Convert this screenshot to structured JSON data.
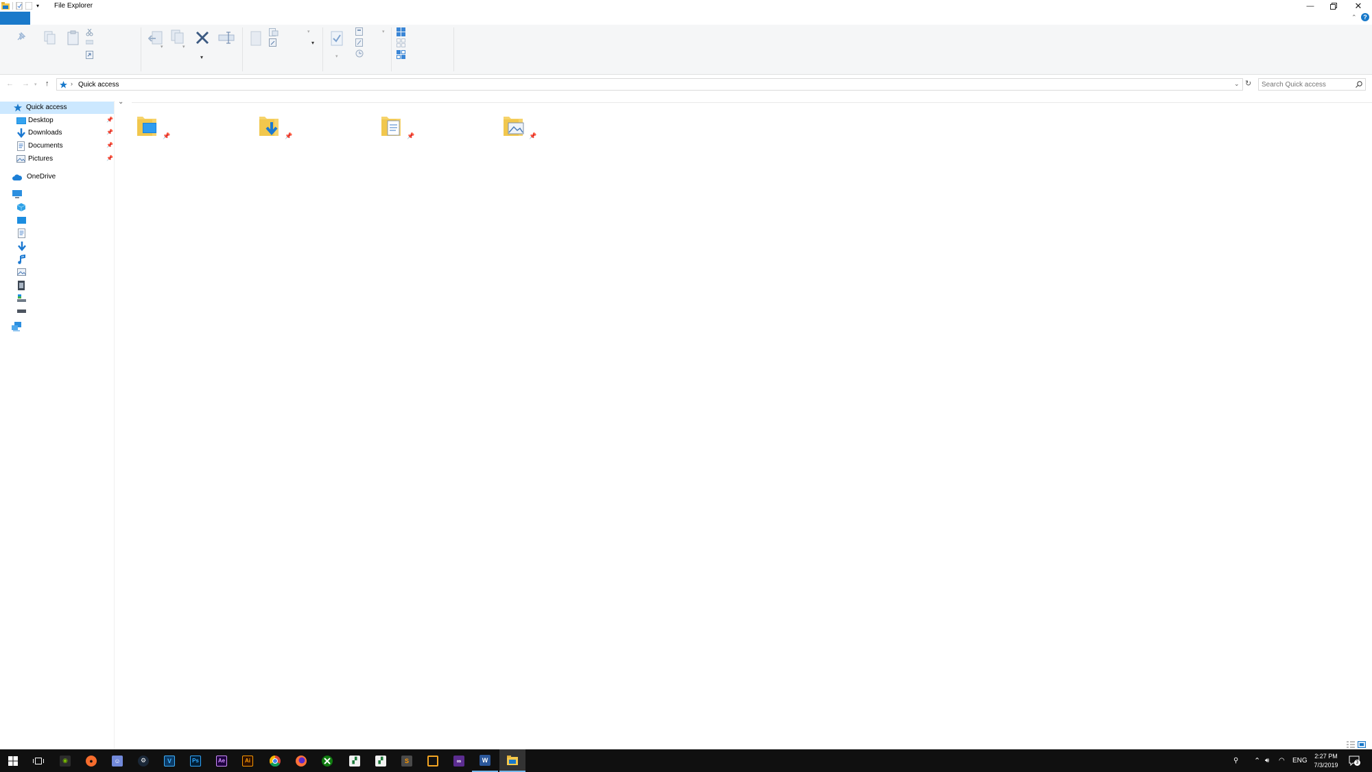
{
  "window": {
    "title": "File Explorer"
  },
  "address": {
    "crumb": "Quick access",
    "search_placeholder": "Search Quick access"
  },
  "nav": {
    "quick_access": "Quick access",
    "pinned": [
      {
        "label": "Desktop"
      },
      {
        "label": "Downloads"
      },
      {
        "label": "Documents"
      },
      {
        "label": "Pictures"
      }
    ],
    "onedrive": "OneDrive"
  },
  "tray": {
    "language": "ENG",
    "time": "2:27 PM",
    "date": "7/3/2019",
    "notification_count": "3"
  },
  "colors": {
    "accent": "#1979ca",
    "selection": "#cce8ff",
    "taskbar": "#101010",
    "folder": "#f6d36b"
  }
}
